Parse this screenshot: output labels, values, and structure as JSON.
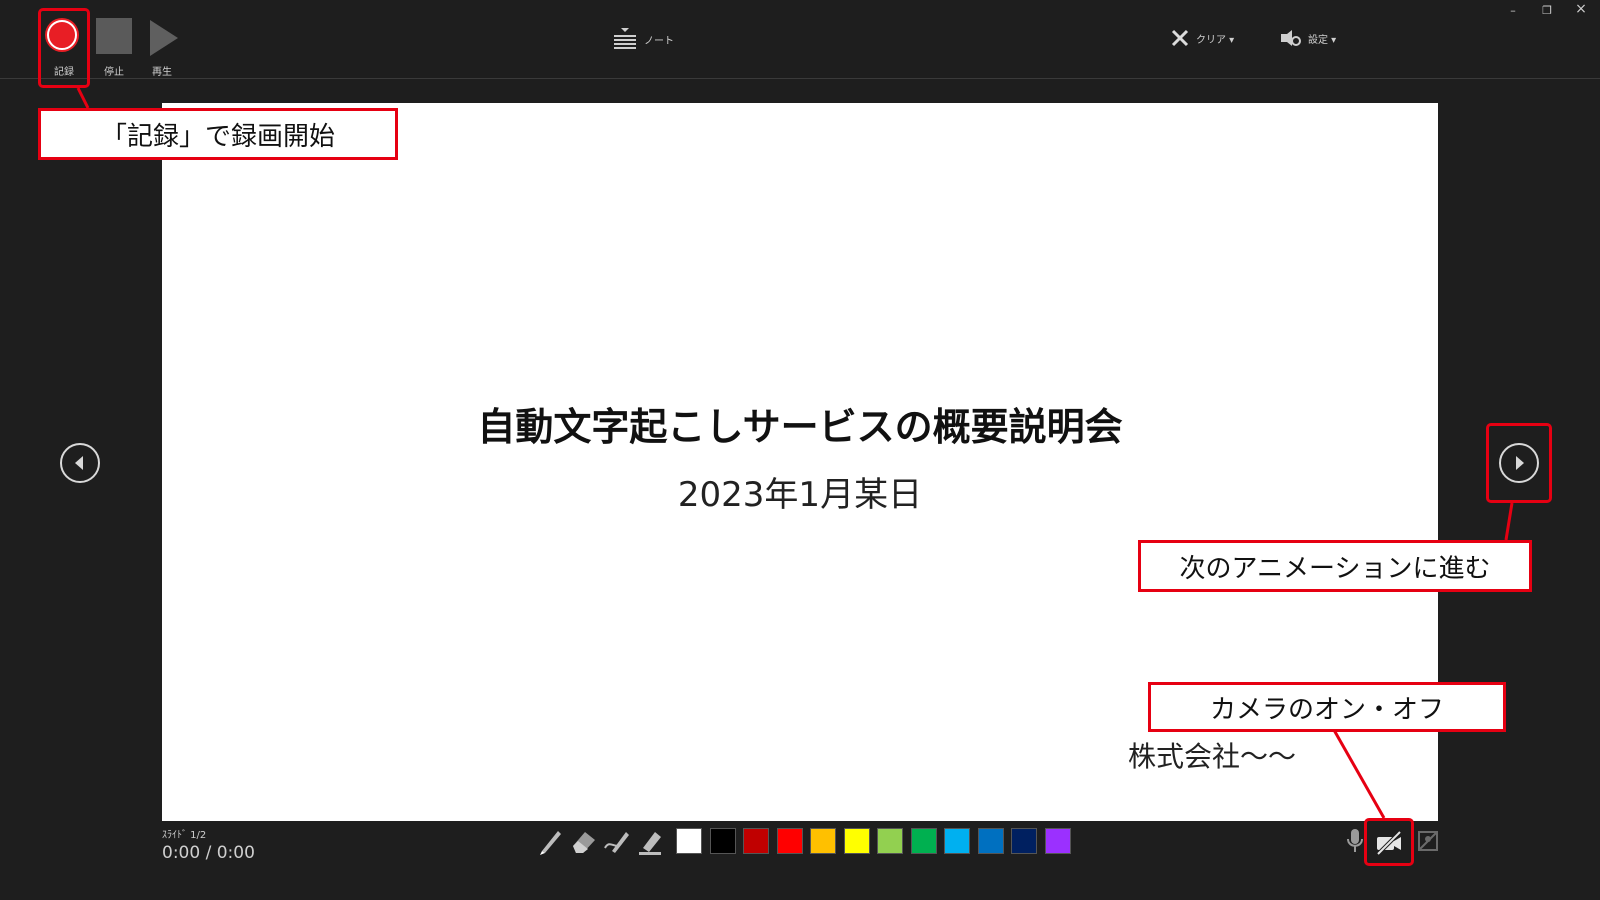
{
  "toolbar": {
    "record_label": "記録",
    "stop_label": "停止",
    "play_label": "再生",
    "notes_label": "ノート",
    "clear_label": "クリア ▾",
    "settings_label": "設定 ▾"
  },
  "window": {
    "minimize": "–",
    "restore": "❐",
    "close": "×"
  },
  "slide": {
    "title": "自動文字起こしサービスの概要説明会",
    "date": "2023年1月某日",
    "company": "株式会社〜〜"
  },
  "status": {
    "slide_counter": "ｽﾗｲﾄﾞ 1/2",
    "timer": "0:00 / 0:00"
  },
  "callouts": {
    "record": "「記録」で録画開始",
    "next": "次のアニメーションに進む",
    "camera": "カメラのオン・オフ"
  },
  "pen_colors": [
    "#ffffff",
    "#000000",
    "#c00000",
    "#ff0000",
    "#ffc000",
    "#ffff00",
    "#92d050",
    "#00b050",
    "#00b0f0",
    "#0070c0",
    "#002060",
    "#9b30ff"
  ],
  "colors": {
    "accent": "#e60012",
    "record": "#e81e25"
  },
  "icons": [
    "pen-icon",
    "eraser-icon",
    "laser-pen-icon",
    "highlighter-icon",
    "microphone-icon",
    "camera-off-icon",
    "camera-preview-icon",
    "notes-icon",
    "clear-icon",
    "settings-icon"
  ]
}
